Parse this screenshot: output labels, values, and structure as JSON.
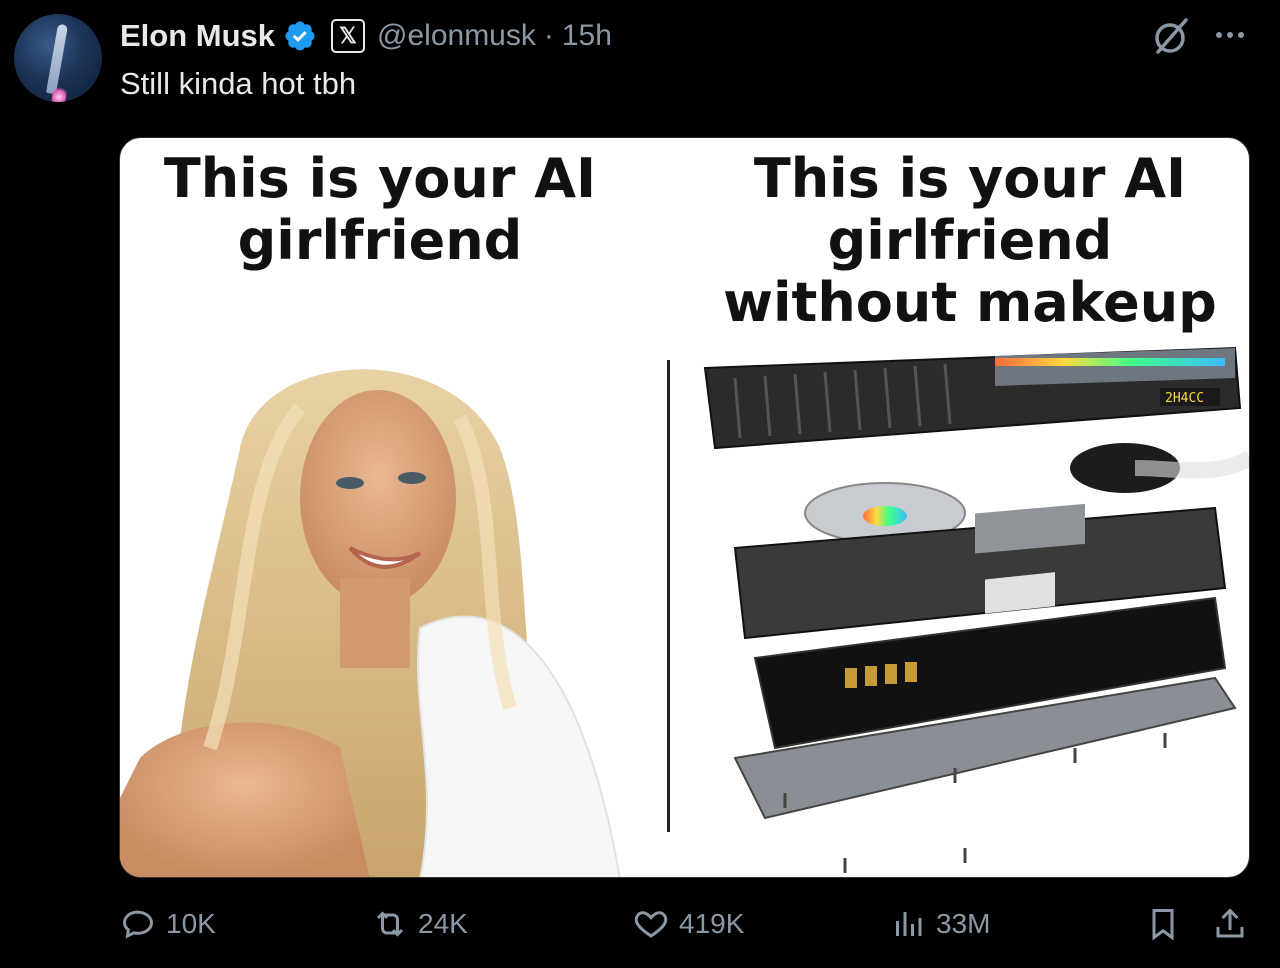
{
  "author": {
    "name": "Elon Musk",
    "handle": "@elonmusk",
    "separator": "·",
    "time": "15h",
    "affiliate_badge": "𝕏"
  },
  "tweet": {
    "text": "Still kinda hot tbh"
  },
  "media": {
    "left_caption": "This is your AI girlfriend",
    "right_caption": "This is your AI girlfriend without makeup",
    "gpu_display_text": "2H4CC"
  },
  "actions": {
    "reply_count": "10K",
    "retweet_count": "24K",
    "like_count": "419K",
    "view_count": "33M"
  },
  "icons": {
    "verified": "verified-badge-icon",
    "grok": "grok-icon",
    "more": "more-icon",
    "reply": "reply-icon",
    "retweet": "retweet-icon",
    "like": "heart-icon",
    "views": "views-icon",
    "bookmark": "bookmark-icon",
    "share": "share-icon"
  },
  "colors": {
    "background": "#000000",
    "text": "#e7e9ea",
    "secondary": "#8b98a5",
    "verified": "#1d9bf0"
  }
}
